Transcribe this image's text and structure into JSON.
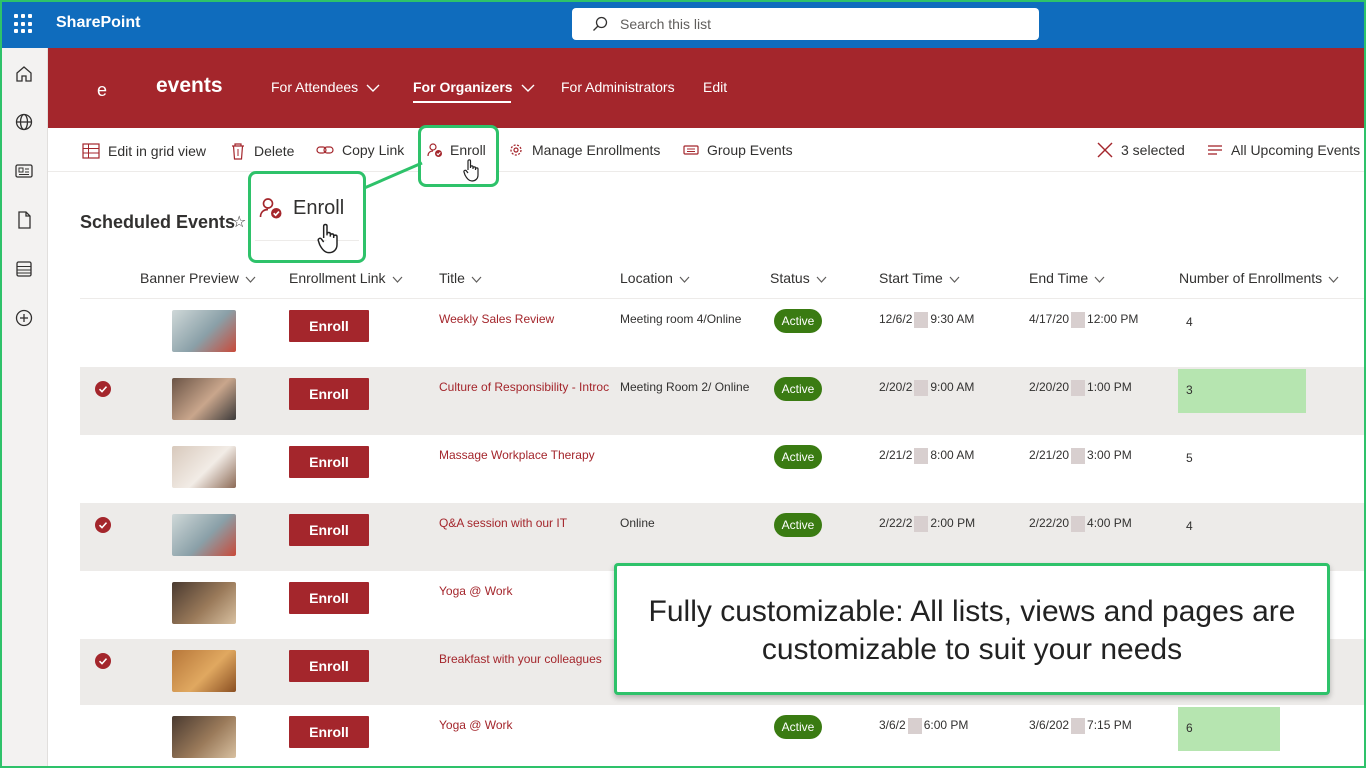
{
  "topbar": {
    "brand": "SharePoint",
    "search_placeholder": "Search this list"
  },
  "hero": {
    "logo": "e",
    "site": "events",
    "nav": [
      {
        "label": "For Attendees",
        "active": false
      },
      {
        "label": "For Organizers",
        "active": true
      },
      {
        "label": "For Administrators",
        "active": false
      },
      {
        "label": "Edit",
        "active": false
      }
    ]
  },
  "cmdbar": {
    "grid": "Edit in grid view",
    "delete": "Delete",
    "copy": "Copy Link",
    "enroll": "Enroll",
    "manage": "Manage Enrollments",
    "group": "Group Events",
    "selected": "3 selected",
    "view": "All Upcoming Events"
  },
  "list": {
    "title": "Scheduled Events",
    "headers": [
      "Banner Preview",
      "Enrollment Link",
      "Title",
      "Location",
      "Status",
      "Start Time",
      "End Time",
      "Number of Enrollments"
    ],
    "rows": [
      {
        "selected": false,
        "enroll": "Enroll",
        "title": "Weekly Sales Review",
        "location": "Meeting room 4/Online",
        "status": "Active",
        "start_a": "12/6/2",
        "start_b": "9:30 AM",
        "end_a": "4/17/20",
        "end_b": "12:00 PM",
        "count": "4",
        "highlight": false
      },
      {
        "selected": true,
        "enroll": "Enroll",
        "title": "Culture of Responsibility - Introc",
        "location": "Meeting Room 2/ Online",
        "status": "Active",
        "start_a": "2/20/2",
        "start_b": "9:00 AM",
        "end_a": "2/20/20",
        "end_b": "1:00 PM",
        "count": "3",
        "highlight": true
      },
      {
        "selected": false,
        "enroll": "Enroll",
        "title": "Massage Workplace Therapy",
        "location": "",
        "status": "Active",
        "start_a": "2/21/2",
        "start_b": "8:00 AM",
        "end_a": "2/21/20",
        "end_b": "3:00 PM",
        "count": "5",
        "highlight": false
      },
      {
        "selected": true,
        "enroll": "Enroll",
        "title": "Q&A session with our IT",
        "location": "Online",
        "status": "Active",
        "start_a": "2/22/2",
        "start_b": "2:00 PM",
        "end_a": "2/22/20",
        "end_b": "4:00 PM",
        "count": "4",
        "highlight": false
      },
      {
        "selected": false,
        "enroll": "Enroll",
        "title": "Yoga @ Work",
        "location": "",
        "status": "",
        "start_a": "",
        "start_b": "",
        "end_a": "",
        "end_b": "",
        "count": "",
        "highlight": false
      },
      {
        "selected": true,
        "enroll": "Enroll",
        "title": "Breakfast with your colleagues",
        "location": "",
        "status": "",
        "start_a": "",
        "start_b": "",
        "end_a": "",
        "end_b": "",
        "count": "",
        "highlight": false
      },
      {
        "selected": false,
        "enroll": "Enroll",
        "title": "Yoga @ Work",
        "location": "",
        "status": "Active",
        "start_a": "3/6/2",
        "start_b": "6:00 PM",
        "end_a": "3/6/202",
        "end_b": "7:15 PM",
        "count": "6",
        "highlight": true
      }
    ]
  },
  "callout": {
    "label": "Enroll"
  },
  "banner": {
    "line1": "Fully customizable: All lists, views and pages are",
    "line2": "customizable to suit your needs"
  },
  "colors": {
    "brand_blue": "#0f6cbd",
    "hero_red": "#a4262c",
    "highlight_green": "#2ec26a",
    "status_green": "#3a7b12",
    "enroll_fill": "#b6e5b0"
  }
}
